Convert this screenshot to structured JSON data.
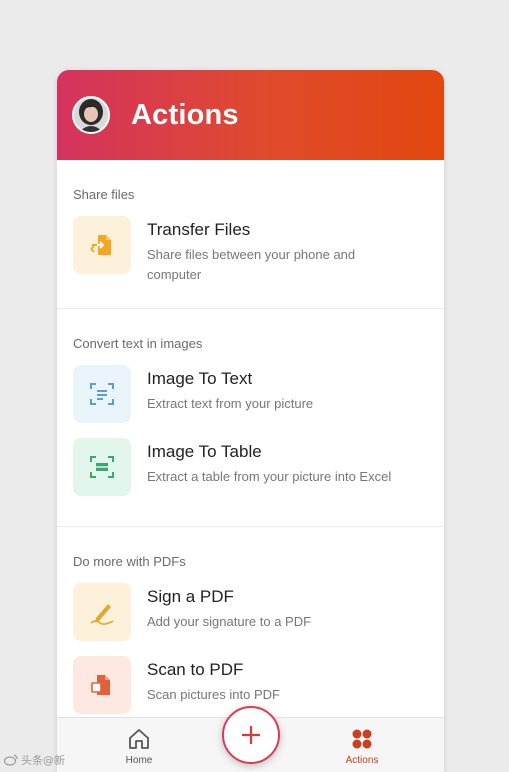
{
  "header": {
    "title": "Actions"
  },
  "sections": [
    {
      "title": "Share files",
      "items": [
        {
          "title": "Transfer Files",
          "description": "Share files between your phone and computer",
          "icon": "transfer-files-icon",
          "color": "#f5a623",
          "bg": "#fdf1dc"
        }
      ]
    },
    {
      "title": "Convert text in images",
      "items": [
        {
          "title": "Image To Text",
          "description": "Extract text from your picture",
          "icon": "image-to-text-icon",
          "color": "#5a9fc9",
          "bg": "#eaf4fb"
        },
        {
          "title": "Image To Table",
          "description": "Extract a table from your picture into Excel",
          "icon": "image-to-table-icon",
          "color": "#3aa770",
          "bg": "#e3f6ec"
        }
      ]
    },
    {
      "title": "Do more with PDFs",
      "items": [
        {
          "title": "Sign a PDF",
          "description": "Add your signature to a PDF",
          "icon": "signature-pen-icon",
          "color": "#e3a92f",
          "bg": "#fdf1dc"
        },
        {
          "title": "Scan to PDF",
          "description": "Scan pictures into PDF",
          "icon": "scan-to-pdf-icon",
          "color": "#e0603c",
          "bg": "#fde9e2"
        }
      ]
    }
  ],
  "nav": {
    "home_label": "Home",
    "actions_label": "Actions",
    "accent": "#c8401f"
  },
  "watermark": "头条@新"
}
